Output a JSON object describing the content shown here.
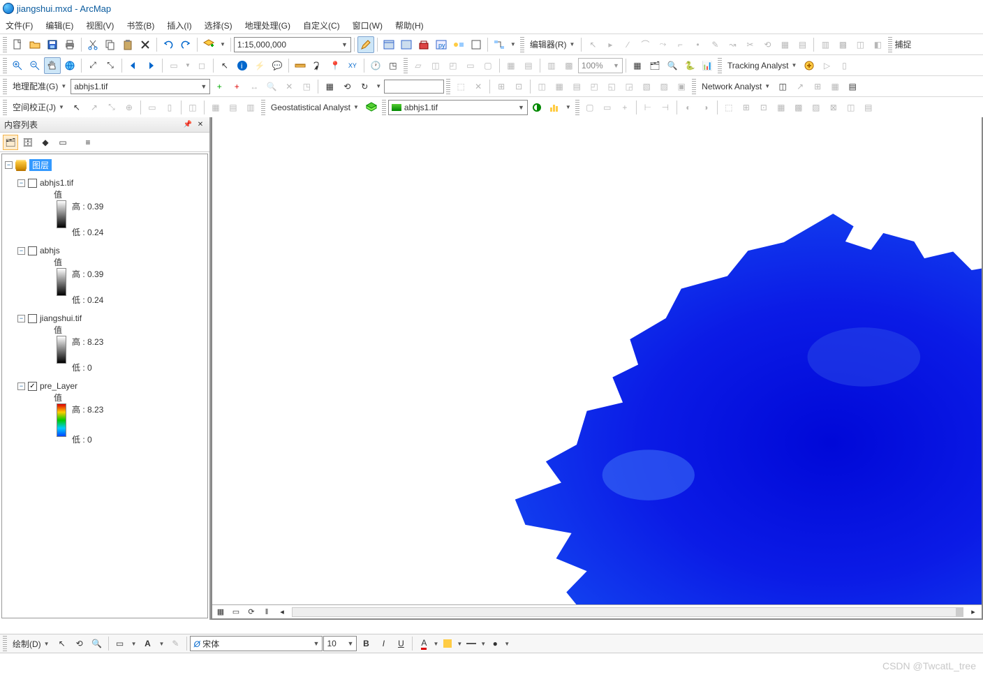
{
  "title": "jiangshui.mxd - ArcMap",
  "menu": [
    "文件(F)",
    "编辑(E)",
    "视图(V)",
    "书签(B)",
    "插入(I)",
    "选择(S)",
    "地理处理(G)",
    "自定义(C)",
    "窗口(W)",
    "帮助(H)"
  ],
  "scale": "1:15,000,000",
  "georef": {
    "label": "地理配准(G)",
    "target": "abhjs1.tif"
  },
  "spatial_adj": "空间校正(J)",
  "editor": "编辑器(R)",
  "georef_input": "",
  "zoom_pct": "100%",
  "geostat": "Geostatistical Analyst",
  "geostat_layer": "abhjs1.tif",
  "tracking": "Tracking Analyst",
  "network": "Network Analyst",
  "capture": "捕捉",
  "toc": {
    "title": "内容列表",
    "root": "图层",
    "layers": [
      {
        "name": "abhjs1.tif",
        "checked": false,
        "val_label": "值",
        "high": "高 : 0.39",
        "low": "低 : 0.24",
        "ramp": "gray"
      },
      {
        "name": "abhjs",
        "checked": false,
        "val_label": "值",
        "high": "高 : 0.39",
        "low": "低 : 0.24",
        "ramp": "gray"
      },
      {
        "name": "jiangshui.tif",
        "checked": false,
        "val_label": "值",
        "high": "高 : 8.23",
        "low": "低 : 0",
        "ramp": "gray"
      },
      {
        "name": "pre_Layer",
        "checked": true,
        "val_label": "值",
        "high": "高 : 8.23",
        "low": "低 : 0",
        "ramp": "rainbow"
      }
    ]
  },
  "draw": {
    "label": "绘制(D)",
    "font_name": "宋体",
    "font_size": "10"
  },
  "watermark": "CSDN @TwcatL_tree"
}
